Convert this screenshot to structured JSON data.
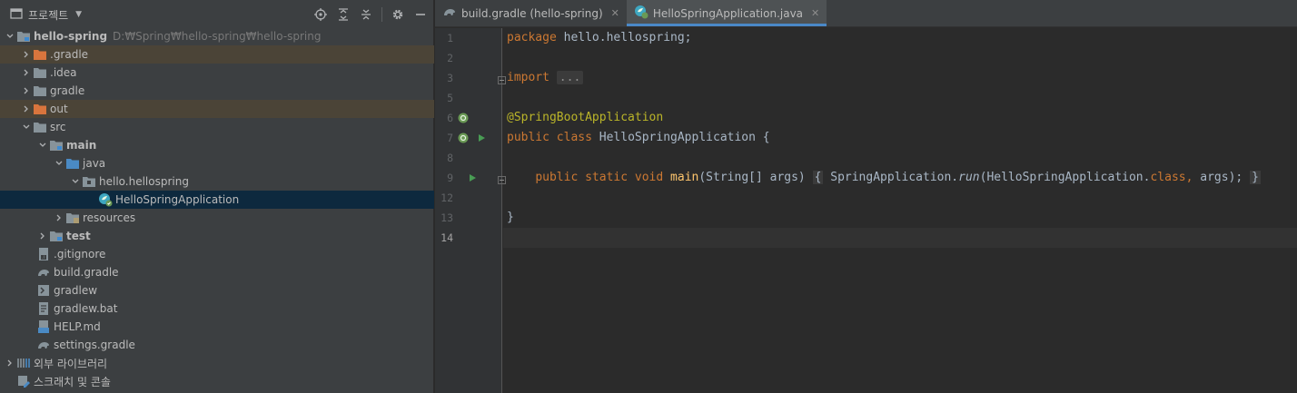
{
  "project_panel": {
    "title": "프로젝트",
    "tree": [
      {
        "label": "hello-spring",
        "hint": "D:₩Spring₩hello-spring₩hello-spring",
        "icon": "module-folder-icon",
        "bold": true
      },
      {
        "label": ".gradle",
        "icon": "folder-icon"
      },
      {
        "label": ".idea",
        "icon": "folder-icon"
      },
      {
        "label": "gradle",
        "icon": "folder-icon"
      },
      {
        "label": "out",
        "icon": "folder-icon"
      },
      {
        "label": "src",
        "icon": "folder-icon"
      },
      {
        "label": "main",
        "icon": "folder-icon",
        "bold": true
      },
      {
        "label": "java",
        "icon": "source-folder-icon"
      },
      {
        "label": "hello.hellospring",
        "icon": "package-icon"
      },
      {
        "label": "HelloSpringApplication",
        "icon": "spring-class-icon"
      },
      {
        "label": "resources",
        "icon": "resources-folder-icon"
      },
      {
        "label": "test",
        "icon": "folder-icon",
        "bold": true
      },
      {
        "label": ".gitignore",
        "icon": "gitignore-icon"
      },
      {
        "label": "build.gradle",
        "icon": "gradle-icon"
      },
      {
        "label": "gradlew",
        "icon": "terminal-file-icon"
      },
      {
        "label": "gradlew.bat",
        "icon": "text-file-icon"
      },
      {
        "label": "HELP.md",
        "icon": "markdown-icon"
      },
      {
        "label": "settings.gradle",
        "icon": "gradle-icon"
      },
      {
        "label": "외부 라이브러리",
        "icon": "libraries-icon"
      },
      {
        "label": "스크래치 및 콘솔",
        "icon": "scratches-icon"
      }
    ]
  },
  "editor": {
    "tabs": [
      {
        "label": "build.gradle (hello-spring)",
        "icon": "gradle-icon",
        "active": false
      },
      {
        "label": "HelloSpringApplication.java",
        "icon": "spring-class-icon",
        "active": true
      }
    ],
    "line_numbers": [
      "1",
      "2",
      "3",
      "5",
      "6",
      "7",
      "8",
      "9",
      "12",
      "13",
      "14"
    ],
    "code": {
      "l1_kw": "package",
      "l1_rest": " hello.hellospring;",
      "l3_kw": "import",
      "l3_fold": "...",
      "l6_ann": "@SpringBootApplication",
      "l7_kw1": "public",
      "l7_kw2": "class",
      "l7_rest": " HelloSpringApplication {",
      "l9_kw1": "public",
      "l9_kw2": "static",
      "l9_kw3": "void",
      "l9_fn": "main",
      "l9_params": "(String[] args)",
      "l9_open": "{",
      "l9_call1": "SpringApplication.",
      "l9_call_it": "run",
      "l9_call2": "(HelloSpringApplication.",
      "l9_class_kw": "class",
      "l9_comma": ",",
      "l9_args": " args);",
      "l9_close": "}",
      "l13": "}"
    }
  },
  "colors": {
    "keyword": "#cc7832",
    "annotation": "#bbb529",
    "method": "#ffc66d",
    "text": "#a9b7c6",
    "tab_accent": "#4a88c7",
    "excluded_bg": "#4b4437",
    "selected_bg": "#0d293e"
  }
}
